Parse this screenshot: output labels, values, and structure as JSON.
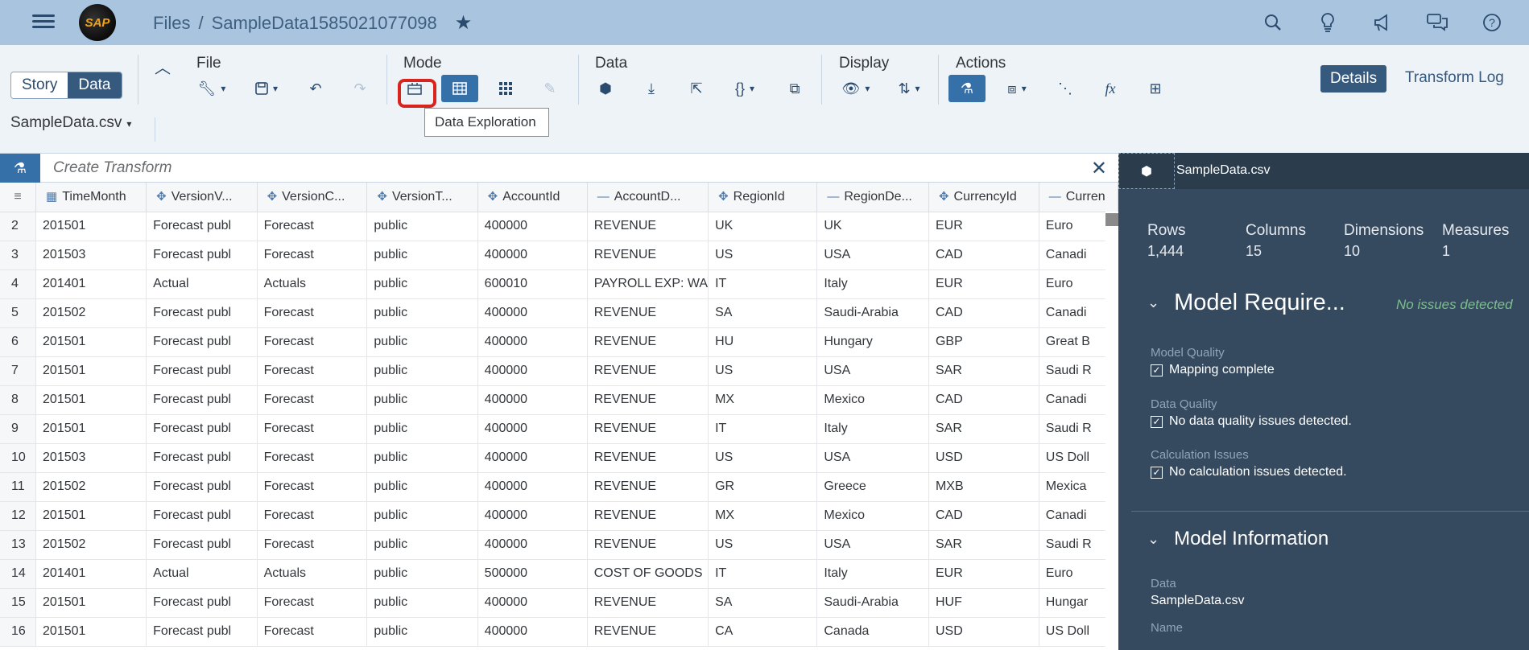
{
  "shell": {
    "logo": "SAP",
    "breadcrumb_root": "Files",
    "breadcrumb_sep": "/",
    "breadcrumb_current": "SampleData1585021077098",
    "icons": [
      "search-icon",
      "lightbulb-icon",
      "megaphone-icon",
      "chat-icon",
      "help-icon"
    ]
  },
  "toolbar": {
    "story_label": "Story",
    "data_label": "Data",
    "group_file": "File",
    "group_mode": "Mode",
    "group_data": "Data",
    "group_display": "Display",
    "group_actions": "Actions",
    "tooltip": "Data Exploration",
    "details_label": "Details",
    "transform_log_label": "Transform Log",
    "file_select": "SampleData.csv"
  },
  "transform": {
    "placeholder": "Create Transform"
  },
  "grid": {
    "columns": [
      "TimeMonth",
      "VersionV...",
      "VersionC...",
      "VersionT...",
      "AccountId",
      "AccountD...",
      "RegionId",
      "RegionDe...",
      "CurrencyId",
      "Curren"
    ],
    "rows": [
      {
        "n": "2",
        "c": [
          "201501",
          "Forecast publ",
          "Forecast",
          "public",
          "400000",
          "REVENUE",
          "UK",
          "UK",
          "EUR",
          "Euro"
        ]
      },
      {
        "n": "3",
        "c": [
          "201503",
          "Forecast publ",
          "Forecast",
          "public",
          "400000",
          "REVENUE",
          "US",
          "USA",
          "CAD",
          "Canadi"
        ]
      },
      {
        "n": "4",
        "c": [
          "201401",
          "Actual",
          "Actuals",
          "public",
          "600010",
          "PAYROLL EXP: WA",
          "IT",
          "Italy",
          "EUR",
          "Euro"
        ]
      },
      {
        "n": "5",
        "c": [
          "201502",
          "Forecast publ",
          "Forecast",
          "public",
          "400000",
          "REVENUE",
          "SA",
          "Saudi-Arabia",
          "CAD",
          "Canadi"
        ]
      },
      {
        "n": "6",
        "c": [
          "201501",
          "Forecast publ",
          "Forecast",
          "public",
          "400000",
          "REVENUE",
          "HU",
          "Hungary",
          "GBP",
          "Great B"
        ]
      },
      {
        "n": "7",
        "c": [
          "201501",
          "Forecast publ",
          "Forecast",
          "public",
          "400000",
          "REVENUE",
          "US",
          "USA",
          "SAR",
          "Saudi R"
        ]
      },
      {
        "n": "8",
        "c": [
          "201501",
          "Forecast publ",
          "Forecast",
          "public",
          "400000",
          "REVENUE",
          "MX",
          "Mexico",
          "CAD",
          "Canadi"
        ]
      },
      {
        "n": "9",
        "c": [
          "201501",
          "Forecast publ",
          "Forecast",
          "public",
          "400000",
          "REVENUE",
          "IT",
          "Italy",
          "SAR",
          "Saudi R"
        ]
      },
      {
        "n": "10",
        "c": [
          "201503",
          "Forecast publ",
          "Forecast",
          "public",
          "400000",
          "REVENUE",
          "US",
          "USA",
          "USD",
          "US Doll"
        ]
      },
      {
        "n": "11",
        "c": [
          "201502",
          "Forecast publ",
          "Forecast",
          "public",
          "400000",
          "REVENUE",
          "GR",
          "Greece",
          "MXB",
          "Mexica"
        ]
      },
      {
        "n": "12",
        "c": [
          "201501",
          "Forecast publ",
          "Forecast",
          "public",
          "400000",
          "REVENUE",
          "MX",
          "Mexico",
          "CAD",
          "Canadi"
        ]
      },
      {
        "n": "13",
        "c": [
          "201502",
          "Forecast publ",
          "Forecast",
          "public",
          "400000",
          "REVENUE",
          "US",
          "USA",
          "SAR",
          "Saudi R"
        ]
      },
      {
        "n": "14",
        "c": [
          "201401",
          "Actual",
          "Actuals",
          "public",
          "500000",
          "COST OF GOODS",
          "IT",
          "Italy",
          "EUR",
          "Euro"
        ]
      },
      {
        "n": "15",
        "c": [
          "201501",
          "Forecast publ",
          "Forecast",
          "public",
          "400000",
          "REVENUE",
          "SA",
          "Saudi-Arabia",
          "HUF",
          "Hungar"
        ]
      },
      {
        "n": "16",
        "c": [
          "201501",
          "Forecast publ",
          "Forecast",
          "public",
          "400000",
          "REVENUE",
          "CA",
          "Canada",
          "USD",
          "US Doll"
        ]
      }
    ]
  },
  "panel": {
    "title": "SampleData.csv",
    "stats": [
      {
        "label": "Rows",
        "value": "1,444"
      },
      {
        "label": "Columns",
        "value": "15"
      },
      {
        "label": "Dimensions",
        "value": "10"
      },
      {
        "label": "Measures",
        "value": "1"
      }
    ],
    "model_req_title": "Model Require...",
    "no_issues": "No issues detected",
    "model_quality_label": "Model Quality",
    "model_quality_value": "Mapping complete",
    "data_quality_label": "Data Quality",
    "data_quality_value": "No data quality issues detected.",
    "calc_label": "Calculation Issues",
    "calc_value": "No calculation issues detected.",
    "model_info_title": "Model Information",
    "data_label": "Data",
    "data_value": "SampleData.csv",
    "name_label": "Name"
  },
  "colors": {
    "shell": "#a9c4df",
    "accent": "#3670a8",
    "panel": "#354a5f",
    "highlight": "#d8241e"
  }
}
